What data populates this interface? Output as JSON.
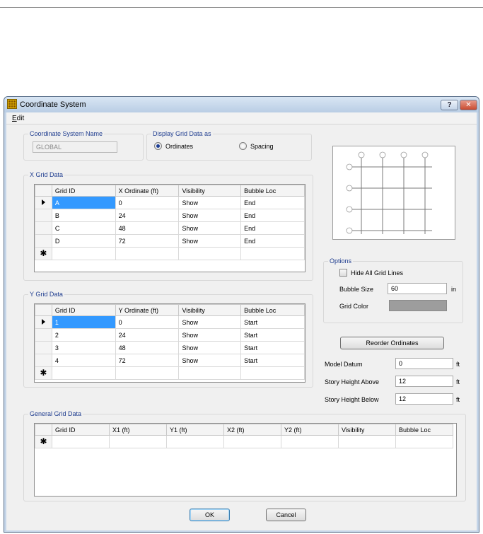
{
  "window": {
    "title": "Coordinate System",
    "help_label": "?",
    "close_label": "✕",
    "icon": "grid-app-icon"
  },
  "menu": {
    "edit": "Edit"
  },
  "coord_name": {
    "group_label": "Coordinate System Name",
    "value": "GLOBAL"
  },
  "display": {
    "group_label": "Display Grid Data as",
    "ordinates": "Ordinates",
    "spacing": "Spacing",
    "selected": "Ordinates"
  },
  "x_grid": {
    "group_label": "X Grid Data",
    "columns": [
      "Grid ID",
      "X Ordinate  (ft)",
      "Visibility",
      "Bubble Loc"
    ],
    "rows": [
      [
        "A",
        "0",
        "Show",
        "End"
      ],
      [
        "B",
        "24",
        "Show",
        "End"
      ],
      [
        "C",
        "48",
        "Show",
        "End"
      ],
      [
        "D",
        "72",
        "Show",
        "End"
      ]
    ]
  },
  "y_grid": {
    "group_label": "Y Grid Data",
    "columns": [
      "Grid ID",
      "Y Ordinate  (ft)",
      "Visibility",
      "Bubble Loc"
    ],
    "rows": [
      [
        "1",
        "0",
        "Show",
        "Start"
      ],
      [
        "2",
        "24",
        "Show",
        "Start"
      ],
      [
        "3",
        "48",
        "Show",
        "Start"
      ],
      [
        "4",
        "72",
        "Show",
        "Start"
      ]
    ]
  },
  "general_grid": {
    "group_label": "General Grid Data",
    "columns": [
      "Grid ID",
      "X1  (ft)",
      "Y1  (ft)",
      "X2  (ft)",
      "Y2  (ft)",
      "Visibility",
      "Bubble Loc"
    ]
  },
  "options": {
    "group_label": "Options",
    "hide_all_label": "Hide All Grid Lines",
    "hide_all_checked": false,
    "bubble_size_label": "Bubble Size",
    "bubble_size_value": "60",
    "bubble_size_unit": "in",
    "grid_color_label": "Grid Color",
    "grid_color": "#9d9d9d"
  },
  "reorder_label": "Reorder Ordinates",
  "model_datum": {
    "label": "Model Datum",
    "value": "0",
    "unit": "ft"
  },
  "story_above": {
    "label": "Story Height Above",
    "value": "12",
    "unit": "ft"
  },
  "story_below": {
    "label": "Story Height Below",
    "value": "12",
    "unit": "ft"
  },
  "buttons": {
    "ok": "OK",
    "cancel": "Cancel"
  },
  "colors": {
    "accent": "#1f3d8f",
    "selection": "#3399ff",
    "titlebar": "#c5d5e8"
  }
}
